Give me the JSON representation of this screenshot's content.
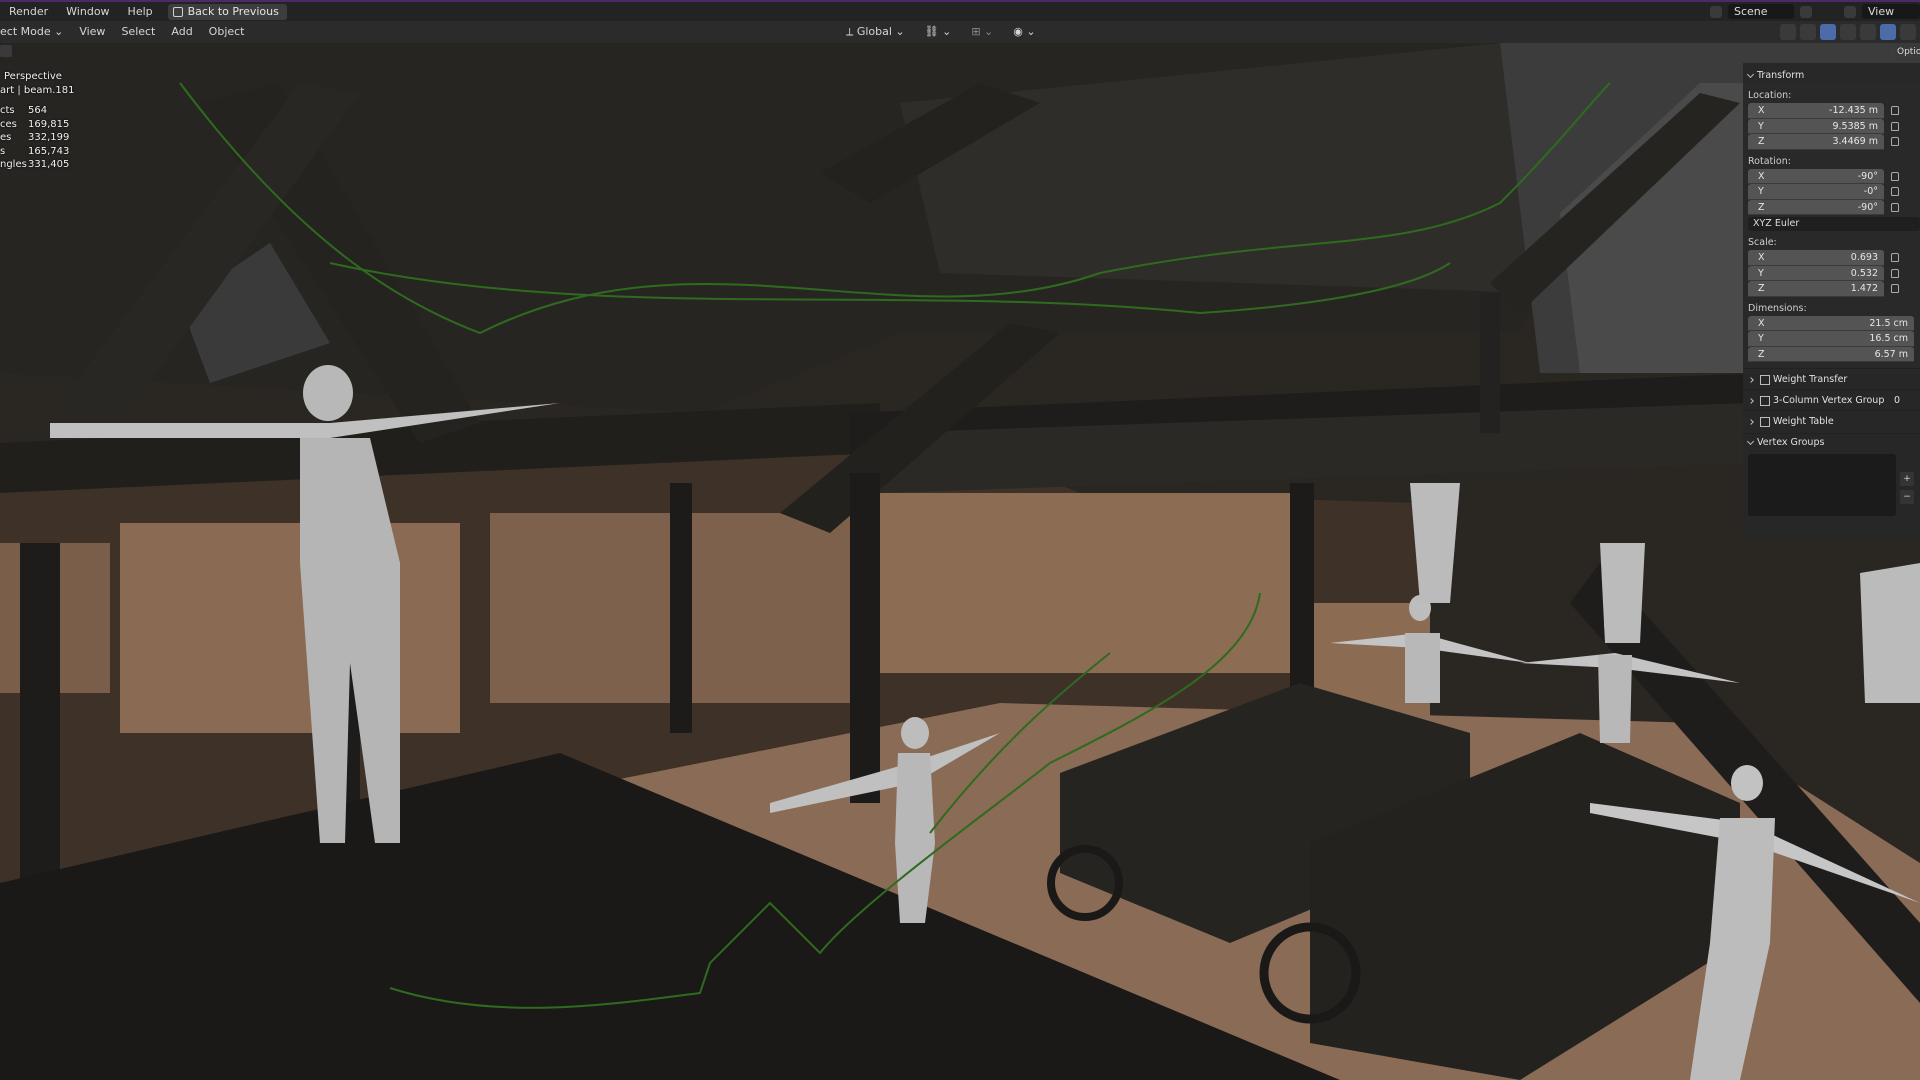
{
  "topbar": {
    "menus": [
      "Render",
      "Window",
      "Help"
    ],
    "back_button": "Back to Previous",
    "scene": "Scene",
    "view_layer": "View Layer"
  },
  "toolbar": {
    "mode": "ect Mode",
    "menus": [
      "View",
      "Select",
      "Add",
      "Object"
    ],
    "orientation": "Global"
  },
  "viewport": {
    "view_name": "Perspective",
    "object_path": "art | beam.181",
    "stats": [
      {
        "label": "cts",
        "value": "564"
      },
      {
        "label": "ces",
        "value": "169,815"
      },
      {
        "label": "es",
        "value": "332,199"
      },
      {
        "label": "s",
        "value": "165,743"
      },
      {
        "label": "ngles",
        "value": "331,405"
      }
    ]
  },
  "npanel": {
    "tab": "Optio",
    "transform_header": "Transform",
    "location_label": "Location:",
    "location": [
      {
        "axis": "X",
        "value": "-12.435 m"
      },
      {
        "axis": "Y",
        "value": "9.5385 m"
      },
      {
        "axis": "Z",
        "value": "3.4469 m"
      }
    ],
    "rotation_label": "Rotation:",
    "rotation": [
      {
        "axis": "X",
        "value": "-90°"
      },
      {
        "axis": "Y",
        "value": "-0°"
      },
      {
        "axis": "Z",
        "value": "-90°"
      }
    ],
    "rotation_mode": "XYZ Euler",
    "scale_label": "Scale:",
    "scale": [
      {
        "axis": "X",
        "value": "0.693"
      },
      {
        "axis": "Y",
        "value": "0.532"
      },
      {
        "axis": "Z",
        "value": "1.472"
      }
    ],
    "dimensions_label": "Dimensions:",
    "dimensions": [
      {
        "axis": "X",
        "value": "21.5 cm"
      },
      {
        "axis": "Y",
        "value": "16.5 cm"
      },
      {
        "axis": "Z",
        "value": "6.57 m"
      }
    ],
    "weight_transfer": "Weight Transfer",
    "three_col": "3-Column Vertex Group",
    "three_col_count": "0",
    "weight_table": "Weight Table",
    "vertex_groups": "Vertex Groups"
  }
}
